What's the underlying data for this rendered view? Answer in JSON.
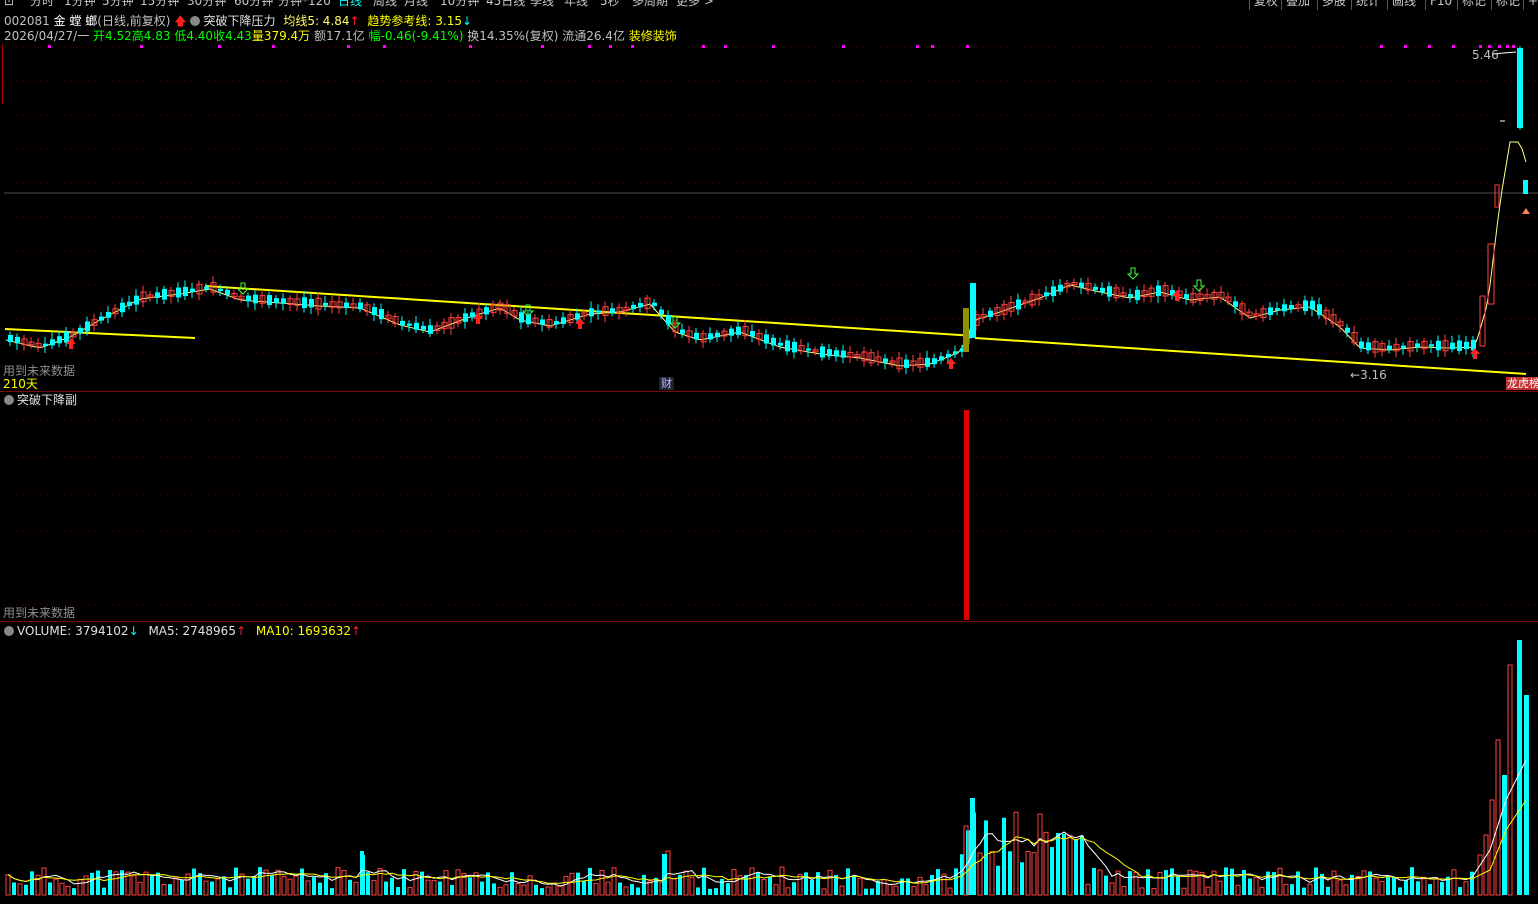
{
  "toolbar": {
    "logo": "⊡",
    "periods": [
      "分时",
      "1分钟",
      "5分钟",
      "15分钟",
      "30分钟",
      "60分钟",
      "分钟*120",
      "日线",
      "周线",
      "月线",
      "10分钟",
      "45日线",
      "季线",
      "年线",
      "5秒",
      "多周期",
      "更多 >"
    ],
    "active_period": "日线",
    "right": [
      "复权",
      "叠加",
      "多股",
      "统计",
      "画线",
      "F10",
      "标记",
      "标记",
      "+"
    ]
  },
  "header": {
    "code": "002081",
    "name": "金 螳 螂",
    "type": "(日线,前复权)",
    "indicator": "突破下降压力",
    "ma5_label": "均线5: 4.84",
    "trend_label": "趋势参考线: 3.15",
    "date": "2026/04/27/一",
    "open": "开4.52",
    "high": "高4.83",
    "low": "低4.40",
    "close": "收4.43",
    "volume": "量379.4万",
    "amount": "额17.1亿",
    "change": "幅-0.46(-9.41%)",
    "turnover": "换14.35%(复权)",
    "float": "流通26.4亿",
    "sector": "装修装饰"
  },
  "main_chart": {
    "future_note": "用到未来数据",
    "days": "210天",
    "high_label": "5.46",
    "low_label": "3.16",
    "fin_marker": "财",
    "board_labels": [
      "龙虎榜",
      "跌"
    ],
    "colors": {
      "up": "#ff4040",
      "down": "#00ffff",
      "trend": "#ffff00",
      "ma": "#ffff80"
    }
  },
  "sub_chart": {
    "title": "突破下降副",
    "future_note": "用到未来数据"
  },
  "volume_chart": {
    "label": "VOLUME: 3794102",
    "ma5": "MA5: 2748965",
    "ma10": "MA10: 1693632"
  },
  "footer": {
    "text": "..."
  }
}
